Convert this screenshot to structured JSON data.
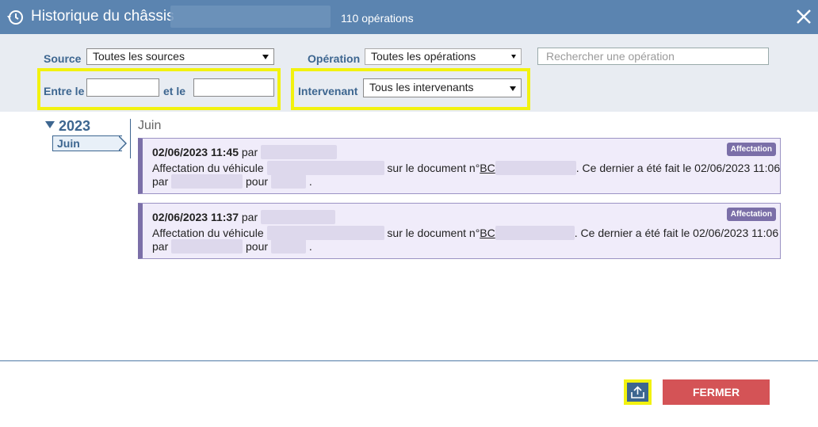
{
  "header": {
    "title": "Historique du châssis",
    "count": "110 opérations"
  },
  "filters": {
    "source_label": "Source",
    "source_value": "Toutes les sources",
    "operation_label": "Opération",
    "operation_value": "Toutes les opérations",
    "search_placeholder": "Rechercher une opération",
    "date_from_label": "Entre le",
    "date_to_label": "et le",
    "intervenant_label": "Intervenant",
    "intervenant_value": "Tous les intervenants"
  },
  "timeline": {
    "year": "2023",
    "month_tab": "Juin",
    "month_heading": "Juin"
  },
  "operations": [
    {
      "datetime": "02/06/2023 11:45",
      "by": "par",
      "badge": "Affectation",
      "text_a": "Affectation du véhicule",
      "text_b": "sur le document n°",
      "doc_prefix": "BC",
      "text_c": ". Ce dernier a été fait le 02/06/2023 11:06",
      "text_d": "par",
      "text_e": "pour",
      "text_f": "."
    },
    {
      "datetime": "02/06/2023 11:37",
      "by": "par",
      "badge": "Affectation",
      "text_a": "Affectation du véhicule",
      "text_b": "sur le document n°",
      "doc_prefix": "BC",
      "text_c": ". Ce dernier a été fait le 02/06/2023 11:06",
      "text_d": "par",
      "text_e": "pour",
      "text_f": "."
    }
  ],
  "footer": {
    "close_label": "FERMER"
  },
  "colors": {
    "header_bg": "#5b84b0",
    "accent": "#3d6690",
    "card_bg": "#f0ecfa",
    "badge_bg": "#7b6fa8",
    "close_button": "#d45356",
    "highlight": "#f2f20f"
  }
}
